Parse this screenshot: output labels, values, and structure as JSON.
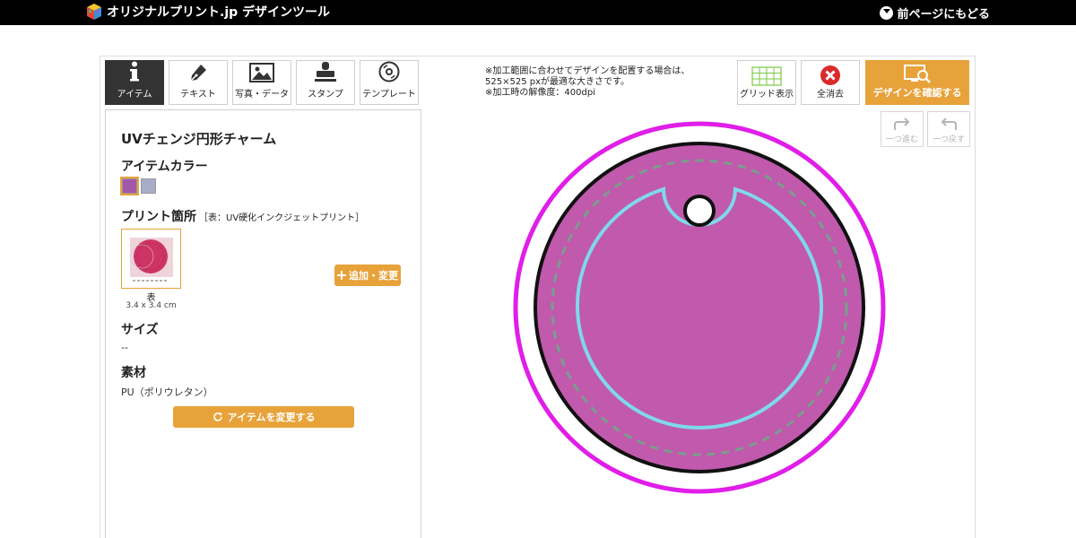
{
  "header": {
    "logo_text": "オリジナルプリント.jp デザインツール",
    "back_label": "前ページにもどる"
  },
  "tabs": [
    {
      "label": "アイテム",
      "icon": "info-icon",
      "active": true
    },
    {
      "label": "テキスト",
      "icon": "pen-icon",
      "active": false
    },
    {
      "label": "写真・データ",
      "icon": "image-icon",
      "active": false
    },
    {
      "label": "スタンプ",
      "icon": "stamp-icon",
      "active": false
    },
    {
      "label": "テンプレート",
      "icon": "disc-icon",
      "active": false
    }
  ],
  "panel": {
    "item_name": "UVチェンジ円形チャーム",
    "color_label": "アイテムカラー",
    "colors": [
      "#a257a8",
      "#a7acc9"
    ],
    "print_label": "プリント箇所",
    "print_note": "［表：UV硬化インクジェットプリント］",
    "thumb_label": "表",
    "thumb_size": "3.4 x 3.4 cm",
    "add_button": "追加・変更",
    "size_label": "サイズ",
    "size_value": "--",
    "material_label": "素材",
    "material_value": "PU（ポリウレタン）",
    "change_item_button": "アイテムを変更する"
  },
  "notes": [
    "※加工範囲に合わせてデザインを配置する場合は、",
    "525×525 pxが最適な大きさです。",
    "※加工時の解像度：400dpi"
  ],
  "toolbar": {
    "grid_label": "グリッド表示",
    "clear_label": "全消去",
    "confirm_label": "デザインを確認する",
    "redo_label": "一つ進む",
    "undo_label": "一つ戻す"
  },
  "colors": {
    "accent": "#e8a23a",
    "charm_fill": "#c159ad",
    "cut_line": "#e01ee8",
    "safe_line": "#7fd8ec",
    "stitch_line": "#7a9e8c"
  }
}
